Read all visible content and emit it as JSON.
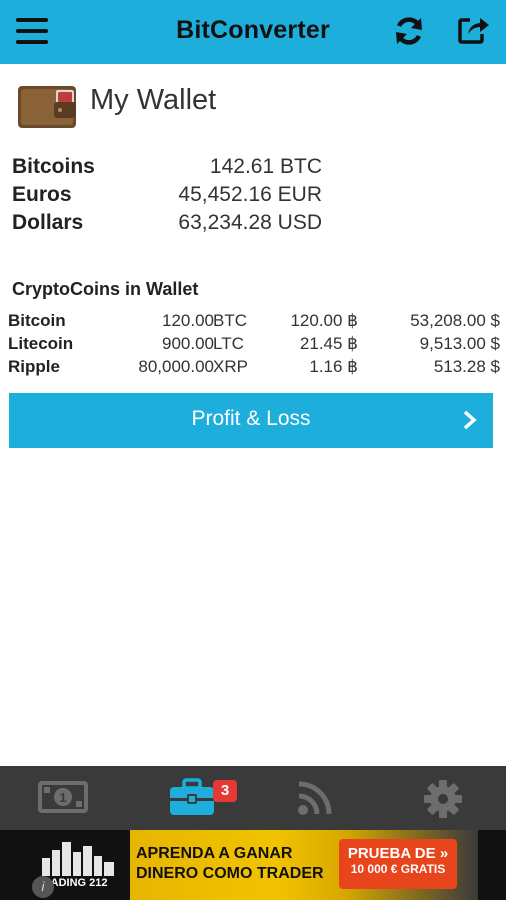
{
  "header": {
    "title": "BitConverter",
    "menu_icon": "hamburger-menu-icon",
    "refresh_icon": "refresh-icon",
    "share_icon": "share-icon",
    "accent_color": "#1eaedb"
  },
  "wallet": {
    "title": "My Wallet",
    "icon": "wallet-icon",
    "summary": [
      {
        "label": "Bitcoins",
        "value": "142.61 BTC"
      },
      {
        "label": "Euros",
        "value": "45,452.16 EUR"
      },
      {
        "label": "Dollars",
        "value": "63,234.28 USD"
      }
    ]
  },
  "cryptocoins": {
    "title": "CryptoCoins in Wallet",
    "rows": [
      {
        "name": "Bitcoin",
        "amount": "120.00",
        "symbol": "BTC",
        "btc_value": "120.00 ฿",
        "usd_value": "53,208.00 $"
      },
      {
        "name": "Litecoin",
        "amount": "900.00",
        "symbol": "LTC",
        "btc_value": "21.45 ฿",
        "usd_value": "9,513.00 $"
      },
      {
        "name": "Ripple",
        "amount": "80,000.00",
        "symbol": "XRP",
        "btc_value": "1.16 ฿",
        "usd_value": "513.28 $"
      }
    ]
  },
  "profit_loss_button": {
    "label": "Profit & Loss",
    "icon": "chevron-right-icon"
  },
  "bottom_nav": {
    "items": [
      {
        "icon": "banknote-icon",
        "active": false
      },
      {
        "icon": "briefcase-icon",
        "active": true,
        "badge": "3"
      },
      {
        "icon": "rss-feed-icon",
        "active": false
      },
      {
        "icon": "gear-icon",
        "active": false
      }
    ],
    "active_color": "#1eaedb",
    "inactive_color": "#6d6d6d"
  },
  "ad": {
    "brand": "TRADING 212",
    "headline_line1": "APRENDA A GANAR",
    "headline_line2": "DINERO COMO TRADER",
    "cta_line1": "PRUEBA DE",
    "cta_line2": "10 000 € GRATIS",
    "info_icon": "info-icon"
  }
}
